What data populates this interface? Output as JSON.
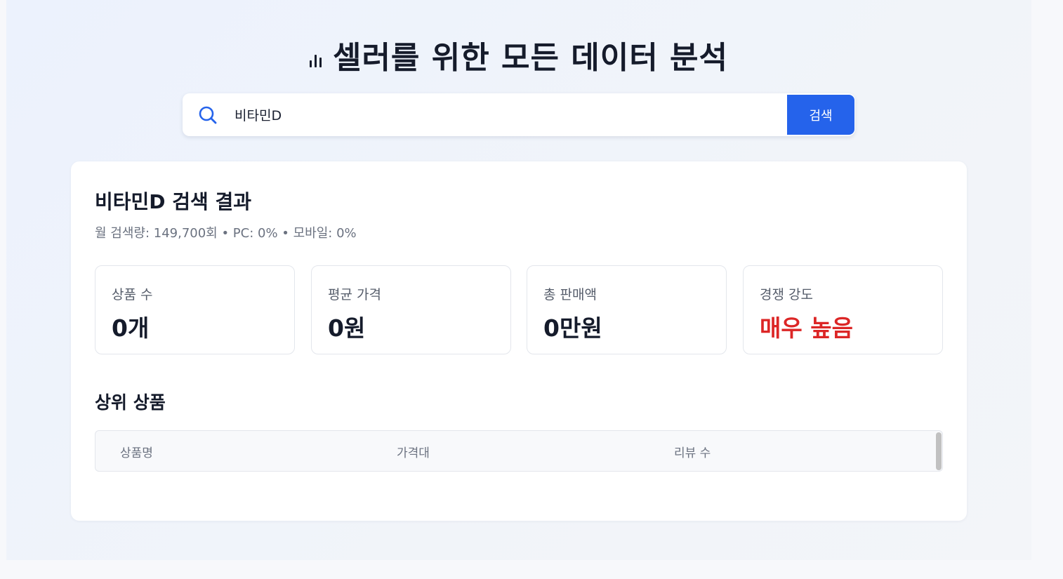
{
  "header": {
    "title": "셀러를 위한 모든 데이터 분석",
    "icon": "bar-chart-icon"
  },
  "search": {
    "value": "비타민D",
    "placeholder": "",
    "button_label": "검색",
    "icon": "search-icon"
  },
  "results": {
    "title": "비타민D 검색 결과",
    "meta": "월 검색량: 149,700회 • PC: 0% • 모바일: 0%",
    "stats": [
      {
        "label": "상품 수",
        "value": "0개"
      },
      {
        "label": "평균 가격",
        "value": "0원"
      },
      {
        "label": "총 판매액",
        "value": "0만원"
      },
      {
        "label": "경쟁 강도",
        "value": "매우 높음"
      }
    ],
    "top_products": {
      "title": "상위 상품",
      "columns": [
        "상품명",
        "가격대",
        "리뷰 수"
      ]
    }
  },
  "colors": {
    "accent": "#2563eb",
    "danger": "#dc2626",
    "text": "#151b2b",
    "muted": "#6b7280"
  }
}
